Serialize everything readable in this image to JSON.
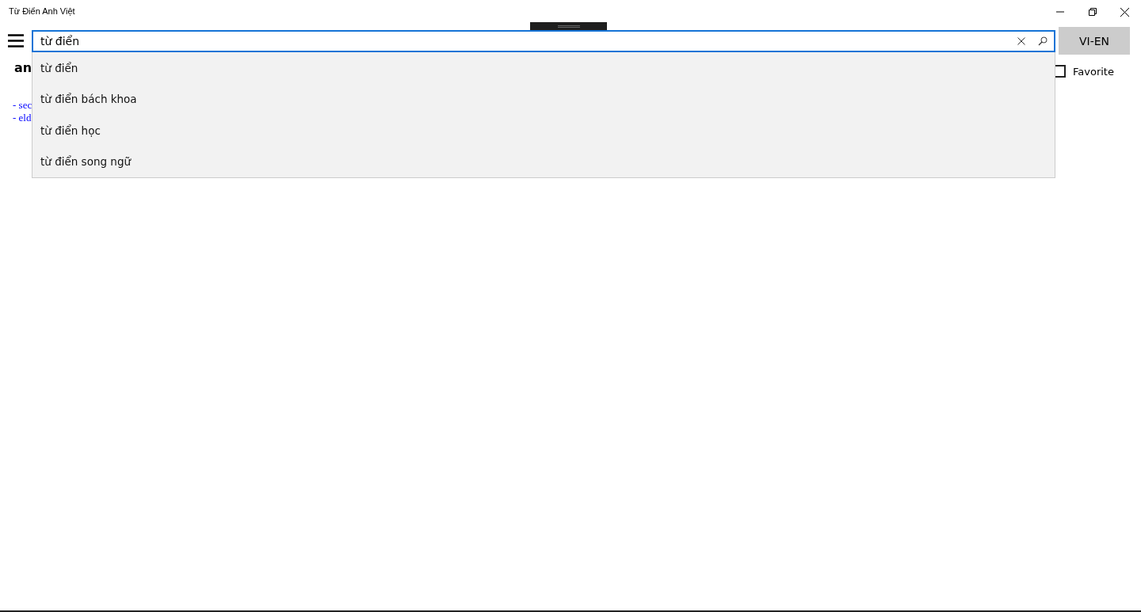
{
  "window": {
    "title": "Từ Điển Anh Việt"
  },
  "search": {
    "value": "từ điển",
    "suggestions": [
      "từ điển",
      "từ điển bách khoa",
      "từ điển học",
      "từ điển song ngữ"
    ]
  },
  "direction_button": {
    "label": "VI-EN"
  },
  "favorite": {
    "label": "Favorite",
    "checked": false
  },
  "entry": {
    "word": "an",
    "lines": [
      "- sec",
      "- eld"
    ]
  }
}
